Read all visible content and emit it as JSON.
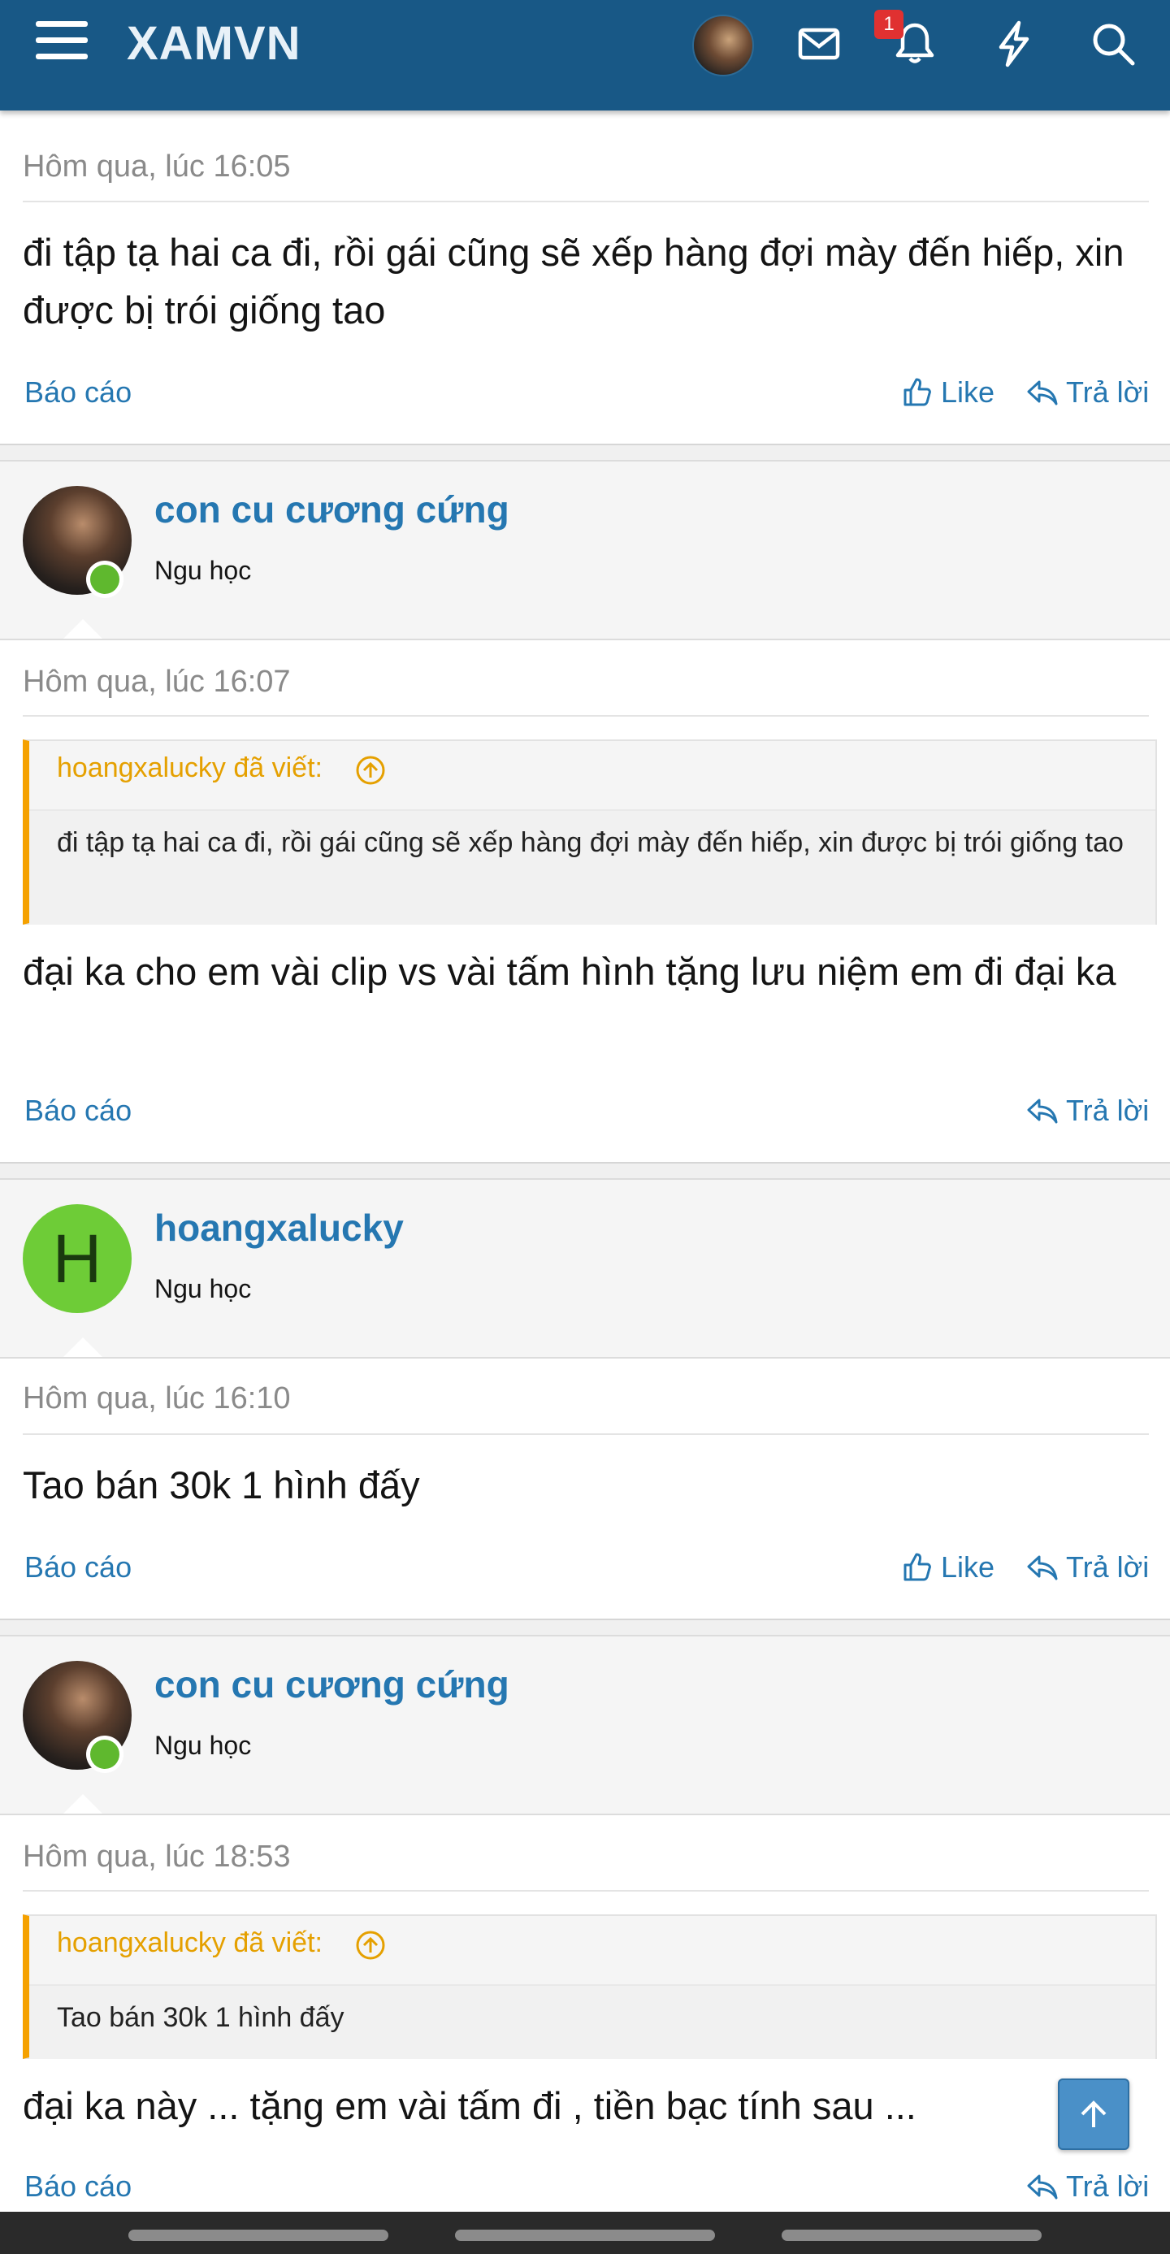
{
  "header": {
    "app_title": "XAMVN",
    "notification_count": "1",
    "icons": [
      "hamburger-icon",
      "user-avatar",
      "mail-icon",
      "bell-icon",
      "lightning-icon",
      "search-icon"
    ],
    "brand_color": "#185886"
  },
  "posts": [
    {
      "timestamp": "Hôm qua, lúc 16:05",
      "body": "đi tập tạ hai ca đi, rồi gái cũng sẽ xếp hàng đợi mày đến hiếp, xin được bị trói giống tao",
      "report_label": "Báo cáo",
      "like_label": "Like",
      "reply_label": "Trả lời"
    },
    {
      "username": "con cu cương cứng",
      "user_title": "Ngu học",
      "timestamp": "Hôm qua, lúc 16:07",
      "quote_author": "hoangxalucky đã viết:",
      "quote_text": "đi tập tạ hai ca đi, rồi gái cũng sẽ xếp hàng đợi mày đến hiếp, xin được bị trói giống tao",
      "body": "đại ka cho em vài clip vs vài tấm hình tặng lưu niệm em đi đại ka",
      "report_label": "Báo cáo",
      "reply_label": "Trả lời"
    },
    {
      "username": "hoangxalucky",
      "avatar_letter": "H",
      "user_title": "Ngu học",
      "timestamp": "Hôm qua, lúc 16:10",
      "body": "Tao bán 30k 1 hình đấy",
      "report_label": "Báo cáo",
      "like_label": "Like",
      "reply_label": "Trả lời"
    },
    {
      "username": "con cu cương cứng",
      "user_title": "Ngu học",
      "timestamp": "Hôm qua, lúc 18:53",
      "quote_author": "hoangxalucky đã viết:",
      "quote_text": "Tao bán 30k 1 hình đấy",
      "body": "đại ka này ... tặng em vài tấm đi , tiền bạc tính sau ...",
      "report_label": "Báo cáo",
      "reply_label": "Trả lời"
    }
  ],
  "colors": {
    "link": "#2577b1",
    "quote_accent": "#f5a100",
    "online": "#5fb82e",
    "avatar_letter_bg": "#6ecc37",
    "badge": "#e03131"
  }
}
